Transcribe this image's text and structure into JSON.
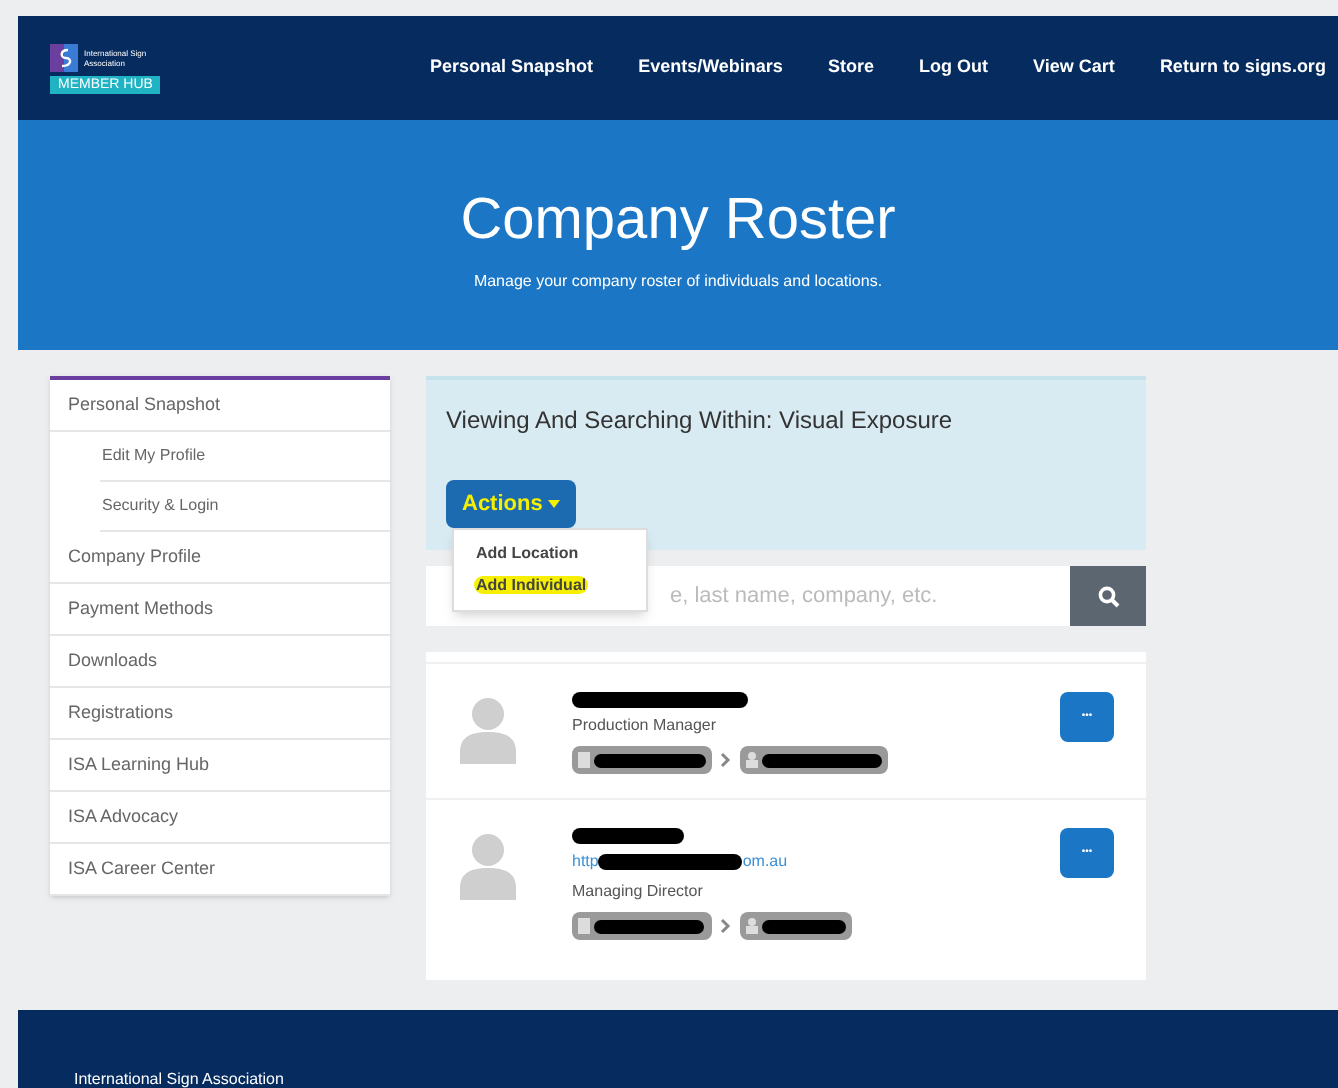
{
  "header": {
    "logo": {
      "org": "International Sign Association",
      "badge": "MEMBER HUB"
    },
    "nav": [
      "Personal Snapshot",
      "Events/Webinars",
      "Store",
      "Log Out",
      "View Cart",
      "Return to signs.org"
    ]
  },
  "hero": {
    "title": "Company Roster",
    "subtitle": "Manage your company roster of individuals and locations."
  },
  "sidebar": {
    "items": [
      {
        "label": "Personal Snapshot",
        "children": [
          {
            "label": "Edit My Profile"
          },
          {
            "label": "Security & Login"
          }
        ]
      },
      {
        "label": "Company Profile"
      },
      {
        "label": "Payment Methods"
      },
      {
        "label": "Downloads"
      },
      {
        "label": "Registrations"
      },
      {
        "label": "ISA Learning Hub"
      },
      {
        "label": "ISA Advocacy"
      },
      {
        "label": "ISA Career Center"
      }
    ]
  },
  "panel": {
    "heading": "Viewing And Searching Within: Visual Exposure",
    "actions_button": "Actions",
    "actions_expanded": true,
    "menu": [
      {
        "label": "Add Location",
        "highlighted": false
      },
      {
        "label": "Add Individual",
        "highlighted": true
      }
    ],
    "search": {
      "placeholder": "e, last name, company, etc."
    }
  },
  "people": [
    {
      "title": "Production Manager",
      "more_button": "•••"
    },
    {
      "website": {
        "start": "http",
        "end": "om.au"
      },
      "title": "Managing Director",
      "more_button": "•••"
    }
  ],
  "footer": {
    "text": "International Sign Association"
  }
}
